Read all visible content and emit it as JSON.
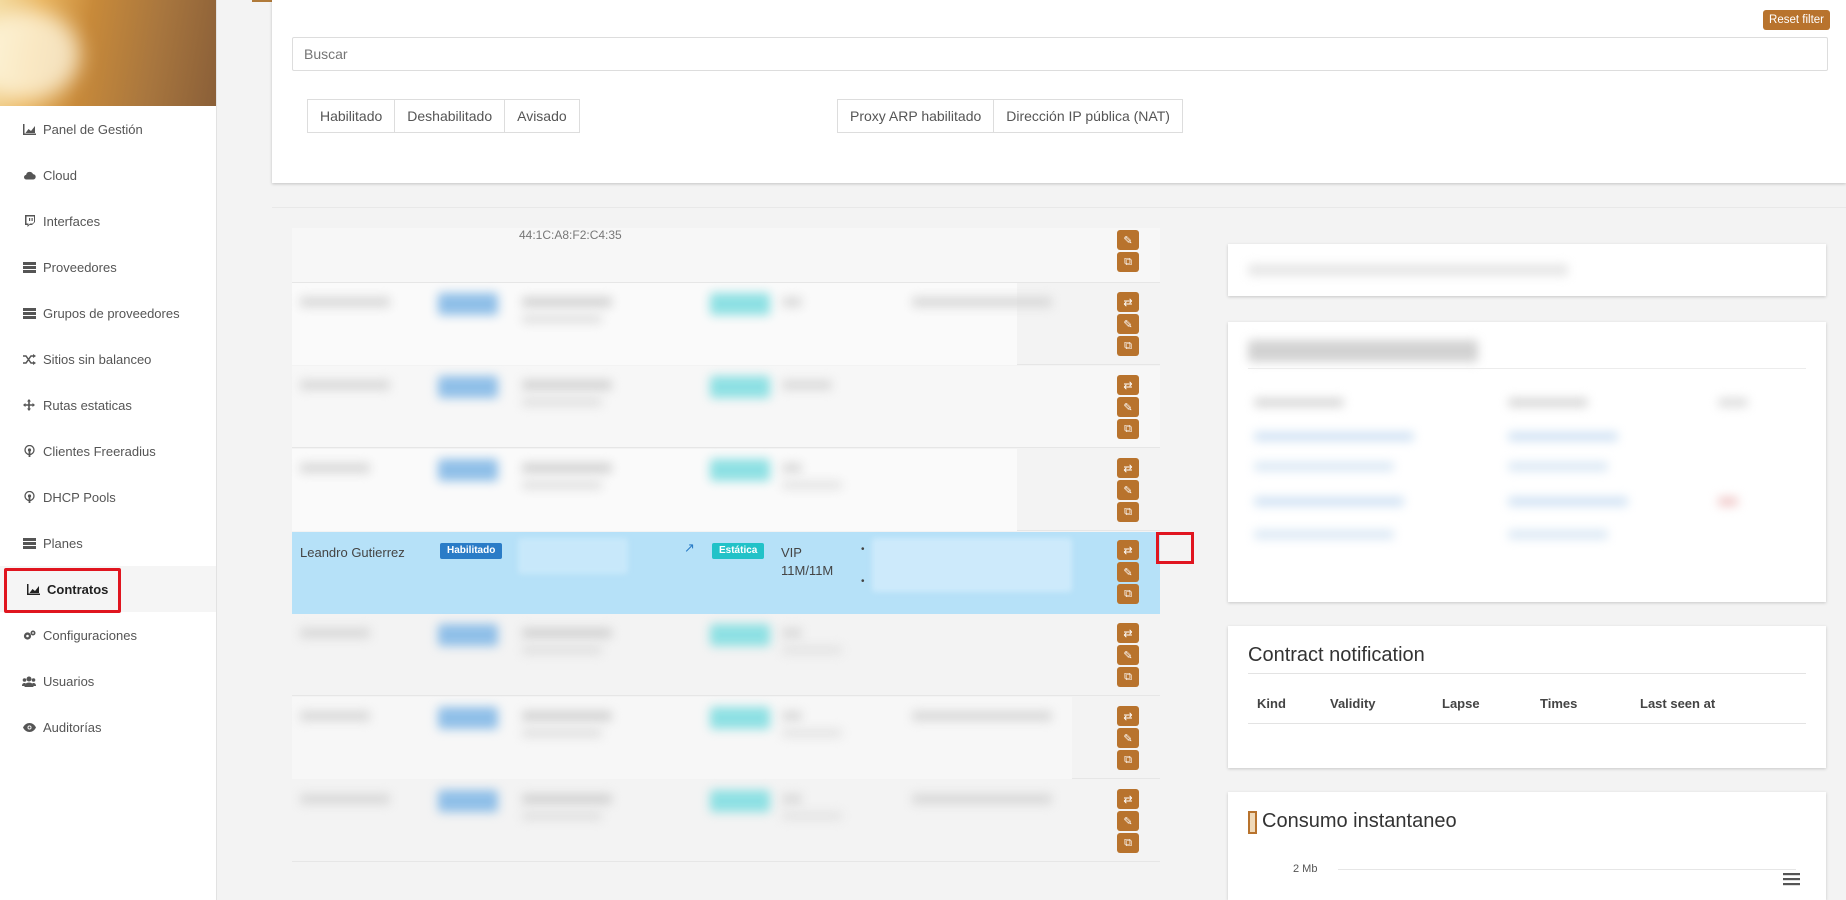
{
  "sidebar": {
    "items": [
      {
        "label": "Panel de Gestión",
        "icon": "area-chart-icon"
      },
      {
        "label": "Cloud",
        "icon": "cloud-icon"
      },
      {
        "label": "Interfaces",
        "icon": "twitch-icon"
      },
      {
        "label": "Proveedores",
        "icon": "server-icon"
      },
      {
        "label": "Grupos de proveedores",
        "icon": "server-icon"
      },
      {
        "label": "Sitios sin balanceo",
        "icon": "random-icon"
      },
      {
        "label": "Rutas estaticas",
        "icon": "arrows-icon"
      },
      {
        "label": "Clientes Freeradius",
        "icon": "podcast-icon"
      },
      {
        "label": "DHCP Pools",
        "icon": "podcast-icon"
      },
      {
        "label": "Planes",
        "icon": "server-icon"
      },
      {
        "label": "Contratos",
        "icon": "area-chart-icon"
      },
      {
        "label": "Configuraciones",
        "icon": "cogs-icon"
      },
      {
        "label": "Usuarios",
        "icon": "users-icon"
      },
      {
        "label": "Auditorías",
        "icon": "eye-icon"
      }
    ],
    "active": "Contratos"
  },
  "filters": {
    "reset_label": "Reset filter",
    "search_placeholder": "Buscar",
    "status_buttons": [
      "Habilitado",
      "Deshabilitado",
      "Avisado"
    ],
    "feature_buttons": [
      "Proxy ARP habilitado",
      "Dirección IP pública (NAT)"
    ]
  },
  "table": {
    "first_row_mac": "44:1C:A8:F2:C4:35",
    "selected_row": {
      "name": "Leandro Gutierrez",
      "status": "Habilitado",
      "type": "Estática",
      "plan_line1": "VIP",
      "plan_line2": "11M/11M"
    }
  },
  "right": {
    "notification": {
      "title": "Contract notification",
      "columns": [
        "Kind",
        "Validity",
        "Lapse",
        "Times",
        "Last seen at"
      ]
    },
    "consumo": {
      "title": "Consumo instantaneo",
      "y_tick": "2 Mb"
    }
  },
  "colors": {
    "accent": "#b8732d",
    "selected_row": "#b6e1f8",
    "badge_blue": "#2a7cc7",
    "badge_cyan": "#22c2c8",
    "highlight": "#e0151f"
  }
}
